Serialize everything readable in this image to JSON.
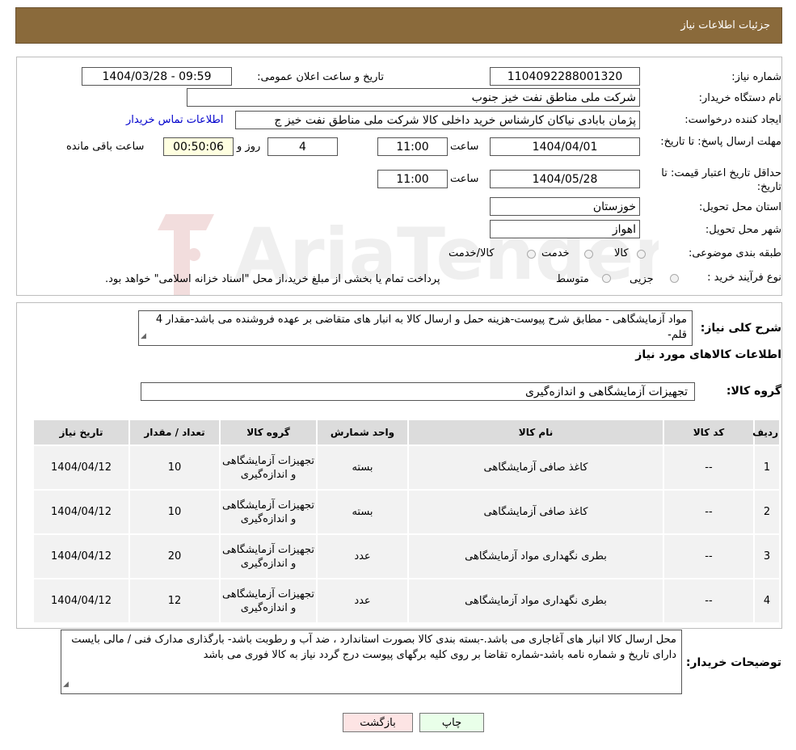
{
  "header": {
    "title": "جزئیات اطلاعات نیاز"
  },
  "form": {
    "need_number_label": "شماره نیاز:",
    "need_number": "1104092288001320",
    "announce_label": "تاریخ و ساعت اعلان عمومی:",
    "announce_value": "1404/03/28 - 09:59",
    "buyer_label": "نام دستگاه خریدار:",
    "buyer_value": "شرکت ملی مناطق نفت خیز جنوب",
    "creator_label": "ایجاد کننده درخواست:",
    "creator_value": "پژمان  بابادی نیاکان  کارشناس خرید داخلی کالا  شرکت ملی مناطق نفت خیز ج",
    "contact_link": "اطلاعات تماس خریدار",
    "deadline_label": "مهلت ارسال پاسخ: تا تاریخ:",
    "deadline_date": "1404/04/01",
    "time_label": "ساعت",
    "deadline_time": "11:00",
    "days_value": "4",
    "days_label": "روز و",
    "remaining_time": "00:50:06",
    "remaining_label": "ساعت باقی مانده",
    "validity_label": "حداقل تاریخ اعتبار قیمت: تا تاریخ:",
    "validity_date": "1404/05/28",
    "validity_time": "11:00",
    "province_label": "استان محل تحویل:",
    "province_value": "خوزستان",
    "city_label": "شهر محل تحویل:",
    "city_value": "اهواز",
    "category_label": "طبقه بندی موضوعی:",
    "category_options": [
      "کالا",
      "خدمت",
      "کالا/خدمت"
    ],
    "process_label": "نوع فرآیند خرید :",
    "process_options": [
      "جزیی",
      "متوسط"
    ],
    "process_note": "پرداخت تمام یا بخشی از مبلغ خرید،از محل \"اسناد خزانه اسلامی\" خواهد بود."
  },
  "summary": {
    "label": "شرح کلی نیاز:",
    "text": "مواد آزمایشگاهی - مطابق شرح پیوست-هزینه حمل و ارسال کالا به انبار های  متقاضی بر عهده فروشنده می باشد-مقدار 4 قلم-",
    "items_title": "اطلاعات کالاهای مورد نیاز",
    "group_label": "گروه کالا:",
    "group_value": "تجهیزات آزمایشگاهی و اندازه‌گیری"
  },
  "table": {
    "headers": [
      "ردیف",
      "کد کالا",
      "نام کالا",
      "واحد شمارش",
      "گروه کالا",
      "تعداد / مقدار",
      "تاریخ نیاز"
    ],
    "rows": [
      {
        "row": "1",
        "code": "--",
        "name": "کاغذ صافی آزمایشگاهی",
        "unit": "بسته",
        "group": "تجهیزات آزمایشگاهی و اندازه‌گیری",
        "qty": "10",
        "date": "1404/04/12"
      },
      {
        "row": "2",
        "code": "--",
        "name": "کاغذ صافی آزمایشگاهی",
        "unit": "بسته",
        "group": "تجهیزات آزمایشگاهی و اندازه‌گیری",
        "qty": "10",
        "date": "1404/04/12"
      },
      {
        "row": "3",
        "code": "--",
        "name": "بطری نگهداری مواد آزمایشگاهی",
        "unit": "عدد",
        "group": "تجهیزات آزمایشگاهی و اندازه‌گیری",
        "qty": "20",
        "date": "1404/04/12"
      },
      {
        "row": "4",
        "code": "--",
        "name": "بطری نگهداری مواد آزمایشگاهی",
        "unit": "عدد",
        "group": "تجهیزات آزمایشگاهی و اندازه‌گیری",
        "qty": "12",
        "date": "1404/04/12"
      }
    ]
  },
  "notes": {
    "label": "توضیحات خریدار:",
    "text": "محل ارسال کالا انبار های آغاجاری می باشد.-بسته بندی کالا بصورت استاندارد ، ضد آب و رطوبت باشد- بارگذاری مدارک فنی / مالی بایست دارای تاریخ و شماره نامه باشد-شماره تقاضا بر روی کلیه برگهای پیوست درج گردد نیاز به کالا فوری می باشد"
  },
  "buttons": {
    "print": "چاپ",
    "back": "بازگشت"
  },
  "watermark": {
    "text": "AriaTender.neT"
  },
  "colors": {
    "header_bg": "#8a6a3b",
    "link": "#0000cc",
    "back_button_bg": "#fde4e4",
    "print_button_bg": "#e9ffe9"
  }
}
